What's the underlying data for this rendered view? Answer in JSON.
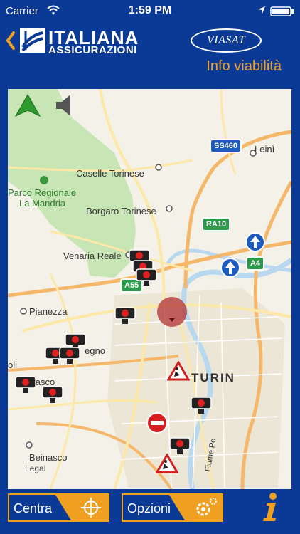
{
  "status": {
    "carrier": "Carrier",
    "time": "1:59 PM"
  },
  "header": {
    "brand_name": "ITALIANA",
    "brand_sub": "ASSICURAZIONI",
    "partner": "VIASAT",
    "title": "Info viabilità"
  },
  "map": {
    "places": {
      "leini": "Leinì",
      "caselle": "Caselle Torinese",
      "park_line1": "Parco Regionale",
      "park_line2": "La Mandria",
      "borgaro": "Borgaro Torinese",
      "venaria": "Venaria Reale",
      "pianezza": "Pianezza",
      "collegno": "egno",
      "grugliasco_a": "oli",
      "grugliasco_b": "liasco",
      "turin": "TURIN",
      "beinasco": "Beinasco",
      "river": "Fiume Po",
      "legal": "Legal"
    },
    "road_signs": {
      "ss460": "SS460",
      "ra10": "RA10",
      "a4": "A4",
      "a55": "A55"
    },
    "icons": [
      "north-arrow-icon",
      "speaker-icon",
      "speed-camera-icon",
      "roadworks-icon",
      "no-entry-icon",
      "one-way-arrow-icon",
      "location-pin-icon"
    ],
    "colors": {
      "park": "#c8e6b5",
      "road": "#fce9a8",
      "water": "#b8d8f0",
      "camera_red": "#e02020"
    }
  },
  "toolbar": {
    "centra_label": "Centra",
    "opzioni_label": "Opzioni"
  },
  "colors": {
    "background": "#0b3a96",
    "accent": "#f0a020"
  }
}
